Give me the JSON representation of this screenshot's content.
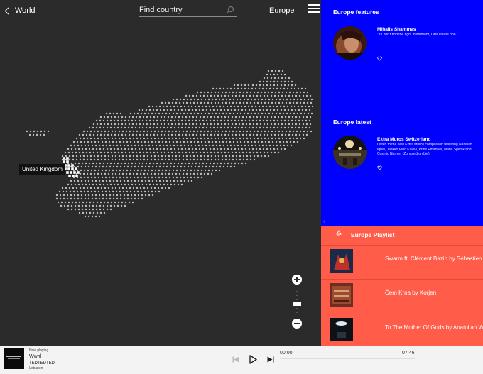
{
  "header": {
    "back_label": "World",
    "search_placeholder": "Find country",
    "region": "Europe"
  },
  "map": {
    "tooltip": "United Kingdom",
    "dot_color": "#bdbdbd",
    "highlight_color": "#ffffff"
  },
  "features": {
    "title": "Europe features",
    "card": {
      "name": "Mihalis Shammas",
      "quote": "\"If I don't find the right instrument, I will create one.\""
    }
  },
  "latest": {
    "title": "Europe latest",
    "card": {
      "name": "Extra Muros Switzerland",
      "description": "Listen to the new Extra Muros compilation featuring Nabihah Iqbal, Jaakko Eino Kalevi, Prins Emanuel, Maria Spivak and Cosmic Namen (Zombie Zombie)"
    }
  },
  "playlist": {
    "title": "Europe Playlist",
    "items": [
      {
        "label": "Swarm ft. Clément Bazin by Sébastien Forrester"
      },
      {
        "label": "Čem Krna by Korjen"
      },
      {
        "label": "To The Mother Of Gods by Anatolian Weapons"
      }
    ]
  },
  "player": {
    "now_playing_label": "Now playing",
    "track": "Wwhl",
    "artist": "TEDTEDTED",
    "label": "Lebanon",
    "time_current": "00:00",
    "time_total": "07:46",
    "progress": 0
  },
  "colors": {
    "map_bg": "#2b2b2b",
    "features_bg": "#0000ff",
    "playlist_bg": "#ff5c4a",
    "player_bg": "#f3f3f3"
  },
  "icons": {
    "back": "chevron-left-icon",
    "search": "search-icon",
    "menu": "hamburger-menu-icon",
    "heart": "heart-icon",
    "playlist": "recycle-icon",
    "prev": "skip-previous-icon",
    "play": "play-icon",
    "next": "skip-next-icon"
  }
}
